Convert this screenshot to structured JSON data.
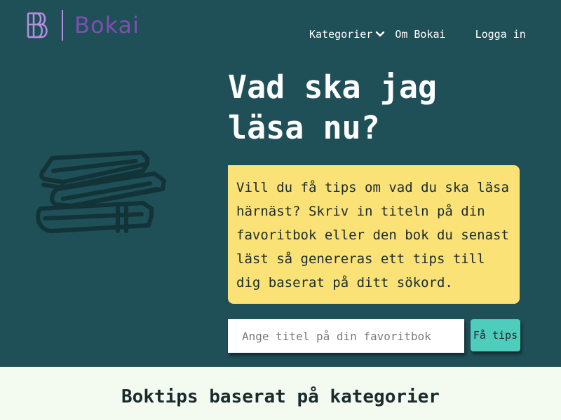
{
  "header": {
    "brand_name": "Bokai",
    "logo_icon": "bb-monogram-icon",
    "nav": {
      "categories_label": "Kategorier",
      "about_label": "Om Bokai",
      "login_label": "Logga in"
    }
  },
  "hero": {
    "title_line1": "Vad ska jag",
    "title_line2": "läsa nu?",
    "illustration_icon": "book-stack-icon",
    "intro_text": "Vill du få tips om vad du ska läsa härnäst? Skriv in titeln på din favoritbok eller den bok du senast läst så genereras ett tips till dig baserat på ditt sökord.",
    "search": {
      "placeholder": "Ange titel på din favoritbok",
      "value": "",
      "button_label": "Få tips"
    }
  },
  "section": {
    "title": "Boktips baserat på kategorier"
  },
  "colors": {
    "hero_background": "#1f4f57",
    "info_box": "#fbe276",
    "button": "#4ecdbd",
    "brand_purple": "#7e4fb0",
    "page_background": "#f3fbf0"
  }
}
